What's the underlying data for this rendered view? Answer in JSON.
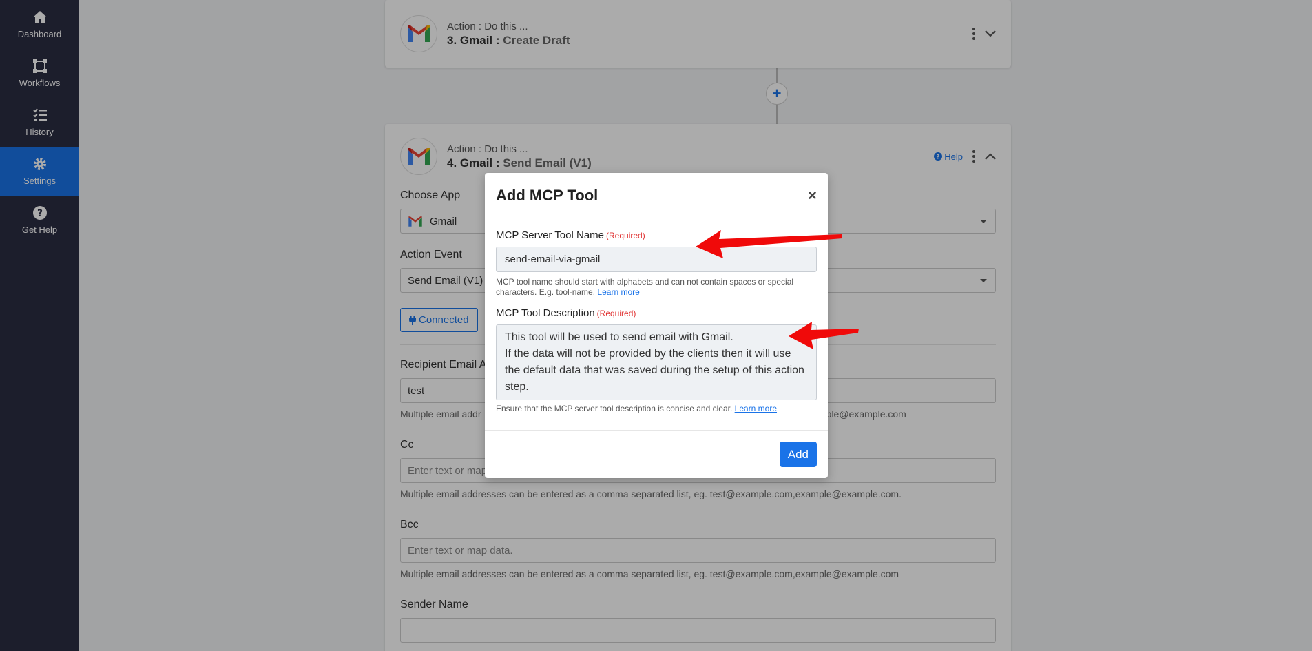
{
  "sidebar": {
    "items": [
      {
        "label": "Dashboard",
        "icon": "home-icon"
      },
      {
        "label": "Workflows",
        "icon": "workflow-icon"
      },
      {
        "label": "History",
        "icon": "history-icon"
      },
      {
        "label": "Settings",
        "icon": "gear-icon",
        "active": true
      },
      {
        "label": "Get Help",
        "icon": "help-icon"
      }
    ]
  },
  "step3": {
    "subtitle": "Action : Do this ...",
    "title": "3. Gmail :",
    "event": "Create Draft"
  },
  "step4": {
    "subtitle": "Action : Do this ...",
    "title": "4. Gmail :",
    "event": "Send Email (V1)",
    "help_label": "Help",
    "choose_app_label": "Choose App",
    "choose_app_value": "Gmail",
    "action_event_label": "Action Event",
    "action_event_value": "Send Email (V1)",
    "connected_label": "Connected",
    "recipient_label": "Recipient Email A",
    "recipient_value": "test",
    "recipient_help": "Multiple email addr",
    "recipient_help_tail": "mple@example.com",
    "cc_label": "Cc",
    "cc_placeholder": "Enter text or map data.",
    "cc_help": "Multiple email addresses can be entered as a comma separated list, eg. test@example.com,example@example.com.",
    "bcc_label": "Bcc",
    "bcc_placeholder": "Enter text or map data.",
    "bcc_help": "Multiple email addresses can be entered as a comma separated list, eg. test@example.com,example@example.com",
    "sender_label": "Sender Name"
  },
  "modal": {
    "title": "Add MCP Tool",
    "close": "×",
    "name_label": "MCP Server Tool Name",
    "required": "(Required)",
    "name_value": "send-email-via-gmail",
    "name_help": "MCP tool name should start with alphabets and can not contain spaces or special characters. E.g. tool-name.",
    "learn_more": "Learn more",
    "desc_label": "MCP Tool Description",
    "desc_line1": "This tool will be used to send email with Gmail.",
    "desc_line2": "If the data will not be provided by the clients then it will use the default data that was saved during the setup of this action step.",
    "desc_help": "Ensure that the MCP server tool description is concise and clear.",
    "add_label": "Add"
  },
  "colors": {
    "accent": "#1a73e8",
    "sidebar": "#2b2d42",
    "required": "#e03131",
    "arrow": "#f00a0a"
  }
}
